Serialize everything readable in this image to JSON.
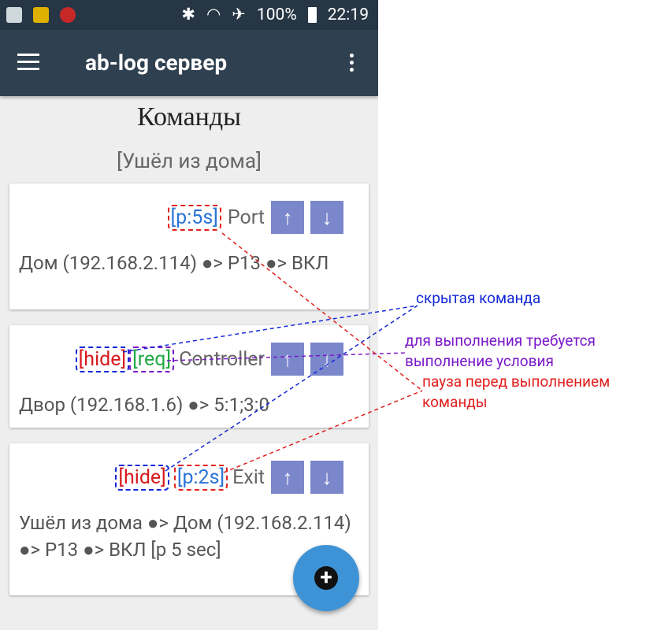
{
  "status_bar": {
    "battery": "100%",
    "time": "22:19"
  },
  "app_bar": {
    "title": "ab-log сервер"
  },
  "page": {
    "title": "Команды",
    "subtitle": "[Ушёл из дома]"
  },
  "cards": [
    {
      "tag_p": "[p:5s]",
      "name": "Port",
      "text": "Дом (192.168.2.114) ●> P13 ●> ВКЛ"
    },
    {
      "tag_hide": "[hide]",
      "tag_req": "[req]",
      "name": "Controller",
      "text": "Двор (192.168.1.6) ●> 5:1;3:0"
    },
    {
      "tag_hide": "[hide]",
      "tag_p": "[p:2s]",
      "name": "Exit",
      "text": "Ушёл из дома ●> Дом (192.168.2.114) ●> P13 ●> ВКЛ [p 5 sec]"
    }
  ],
  "arrows": {
    "up": "↑",
    "down": "↓"
  },
  "annotations": {
    "hidden": "скрытая команда",
    "req": "для выполнения требуется выполнение условия",
    "pause": "пауза перед выполнением команды"
  },
  "colors": {
    "statusbar": "#263645",
    "appbar": "#2f4050",
    "arrow_button": "#7b87cb",
    "fab": "#3d93d6",
    "note_blue": "#1428d8",
    "note_purple": "#7a18c8",
    "note_red": "#e0201e"
  }
}
